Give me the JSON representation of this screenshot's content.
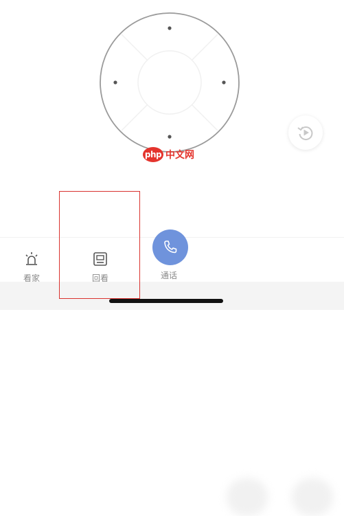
{
  "remote": {
    "dpad": {
      "up_label": "up-button",
      "down_label": "down-button",
      "left_label": "left-button",
      "right_label": "right-button",
      "center_label": "ok-button"
    },
    "replay_icon": "replay-icon"
  },
  "watermark": {
    "logo_text": "php",
    "site_text": "中文网"
  },
  "bottom_nav": {
    "items": [
      {
        "label": "看家",
        "icon": "alarm-light-icon"
      },
      {
        "label": "回看",
        "icon": "playback-icon"
      },
      {
        "label": "通话",
        "icon": "phone-icon"
      }
    ]
  },
  "colors": {
    "accent": "#6f93dc",
    "label": "#8a8a8a",
    "highlight": "#d9322e",
    "watermark": "#e4342d"
  }
}
